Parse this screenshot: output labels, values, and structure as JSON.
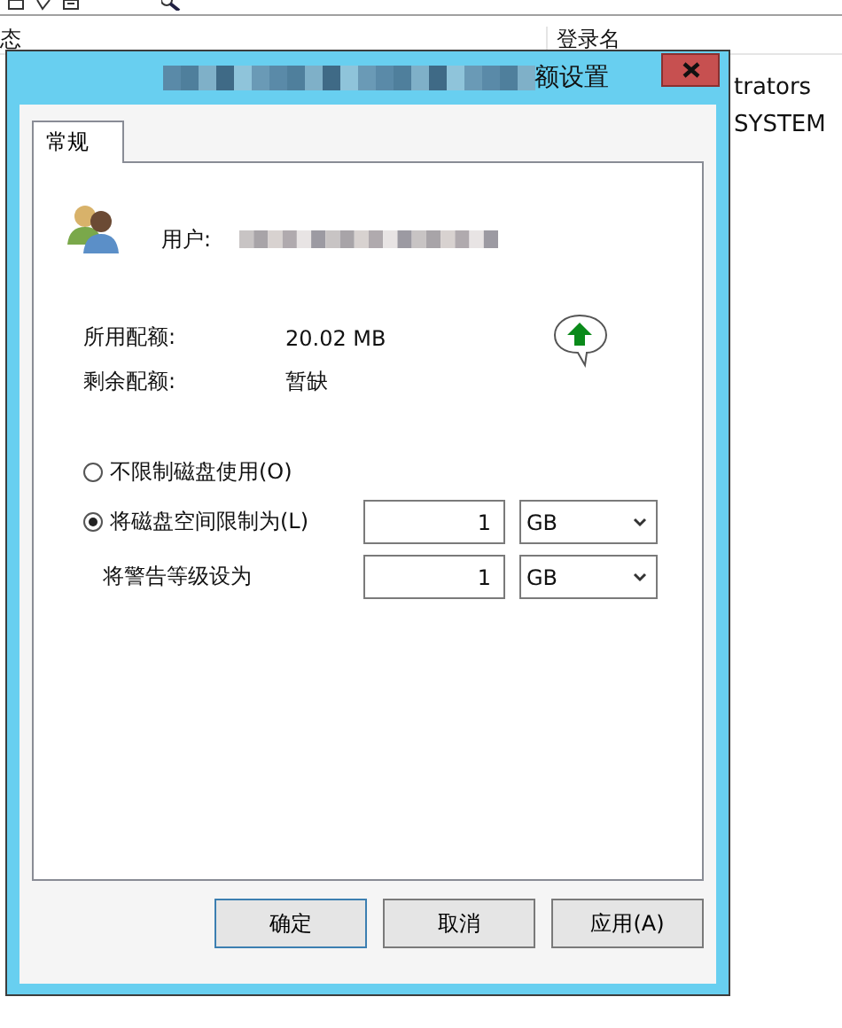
{
  "background": {
    "columns": [
      "态",
      "登录名"
    ],
    "rows": [
      {
        "column_2": "trators"
      },
      {
        "column_2": "SYSTEM"
      }
    ]
  },
  "dialog": {
    "title": "额设置",
    "tabs": [
      {
        "label": "常规",
        "selected": true
      }
    ],
    "user_label": "用户:",
    "quota": [
      {
        "label": "所用配额:",
        "value": "20.02 MB"
      },
      {
        "label": "剩余配额:",
        "value": "暂缺"
      }
    ],
    "options": [
      {
        "label": "不限制磁盘使用(O)",
        "selected": false
      },
      {
        "label": "将磁盘空间限制为(L)",
        "selected": true
      }
    ],
    "limit": {
      "value": "1",
      "unit": "GB"
    },
    "warning": {
      "label": "将警告等级设为",
      "value": "1",
      "unit": "GB"
    },
    "buttons": [
      {
        "label": "确定",
        "default": true
      },
      {
        "label": "取消",
        "default": false
      },
      {
        "label": "应用(A)",
        "default": false
      }
    ]
  }
}
